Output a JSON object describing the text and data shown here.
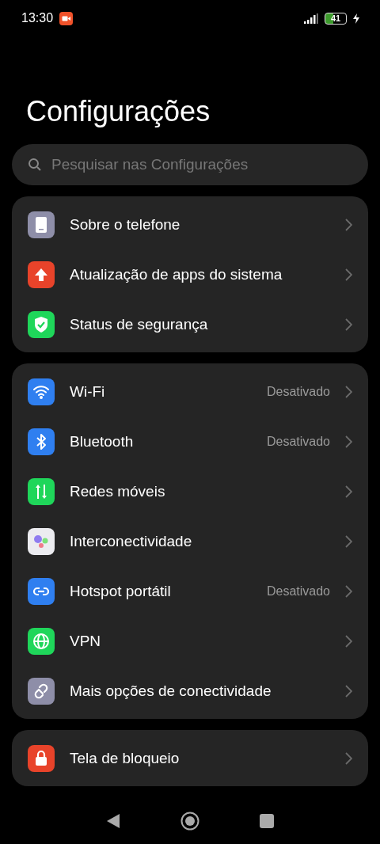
{
  "status_bar": {
    "time": "13:30",
    "battery": "41"
  },
  "title": "Configurações",
  "search": {
    "placeholder": "Pesquisar nas Configurações"
  },
  "groups": [
    {
      "items": [
        {
          "kind": "phone",
          "color": "#8e8ea8",
          "label": "Sobre o telefone"
        },
        {
          "kind": "update",
          "color": "#e8432a",
          "label": "Atualização de apps do sistema"
        },
        {
          "kind": "shield",
          "color": "#1fd65a",
          "label": "Status de segurança"
        }
      ]
    },
    {
      "items": [
        {
          "kind": "wifi",
          "color": "#2f7ff0",
          "label": "Wi-Fi",
          "value": "Desativado"
        },
        {
          "kind": "bluetooth",
          "color": "#2f7ff0",
          "label": "Bluetooth",
          "value": "Desativado"
        },
        {
          "kind": "mobile",
          "color": "#1fd65a",
          "label": "Redes móveis"
        },
        {
          "kind": "connect",
          "color": "#ececf0",
          "label": "Interconectividade"
        },
        {
          "kind": "hotspot",
          "color": "#2f7ff0",
          "label": "Hotspot portátil",
          "value": "Desativado"
        },
        {
          "kind": "vpn",
          "color": "#1fd65a",
          "label": "VPN"
        },
        {
          "kind": "link",
          "color": "#8e8ea8",
          "label": "Mais opções de conectividade"
        }
      ]
    },
    {
      "items": [
        {
          "kind": "lock",
          "color": "#e8432a",
          "label": "Tela de bloqueio"
        }
      ]
    }
  ]
}
